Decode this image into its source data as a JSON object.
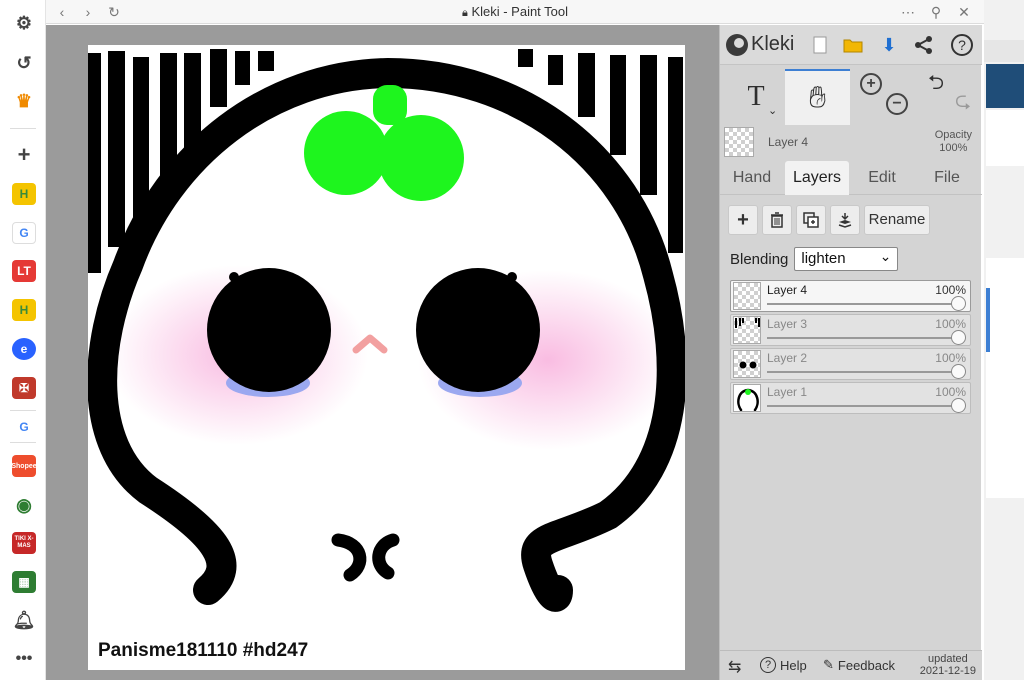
{
  "browser": {
    "title": "Kleki - Paint Tool",
    "sidebar_icons": [
      "gear-icon",
      "history-icon",
      "crown-icon",
      "plus-icon",
      "h-app-icon",
      "google-icon",
      "lt-app-icon",
      "h-app-icon",
      "blue-app-icon",
      "shield-app-icon",
      "google-icon",
      "shopee-icon",
      "chrome-badge-icon",
      "tiki-xmas-icon",
      "sheet-icon",
      "bell-icon",
      "more-icon"
    ],
    "sidebar_labels": {
      "lt": "LT",
      "shopee": "Shopee",
      "tiki": "TIKI X-MAS"
    }
  },
  "canvas": {
    "credit": "Panisme181110 #hd247",
    "colors": {
      "green": "#1ef51e",
      "blush": "#f7a6d8",
      "tears": "#9ba8f0",
      "nose": "#f2a0a0"
    }
  },
  "kleki": {
    "logo": "Kleki",
    "active_layer": {
      "name": "Layer 4",
      "opacity_label": "Opacity",
      "opacity_value": "100%"
    },
    "tabs": [
      "Hand",
      "Layers",
      "Edit",
      "File"
    ],
    "active_tab": "Layers",
    "actions": {
      "rename": "Rename"
    },
    "blending": {
      "label": "Blending",
      "value": "lighten"
    },
    "layers": [
      {
        "name": "Layer 4",
        "opacity": "100%"
      },
      {
        "name": "Layer 3",
        "opacity": "100%"
      },
      {
        "name": "Layer 2",
        "opacity": "100%"
      },
      {
        "name": "Layer 1",
        "opacity": "100%"
      }
    ],
    "bottom": {
      "help": "Help",
      "feedback": "Feedback",
      "updated_label": "updated",
      "updated_date": "2021-12-19"
    }
  }
}
